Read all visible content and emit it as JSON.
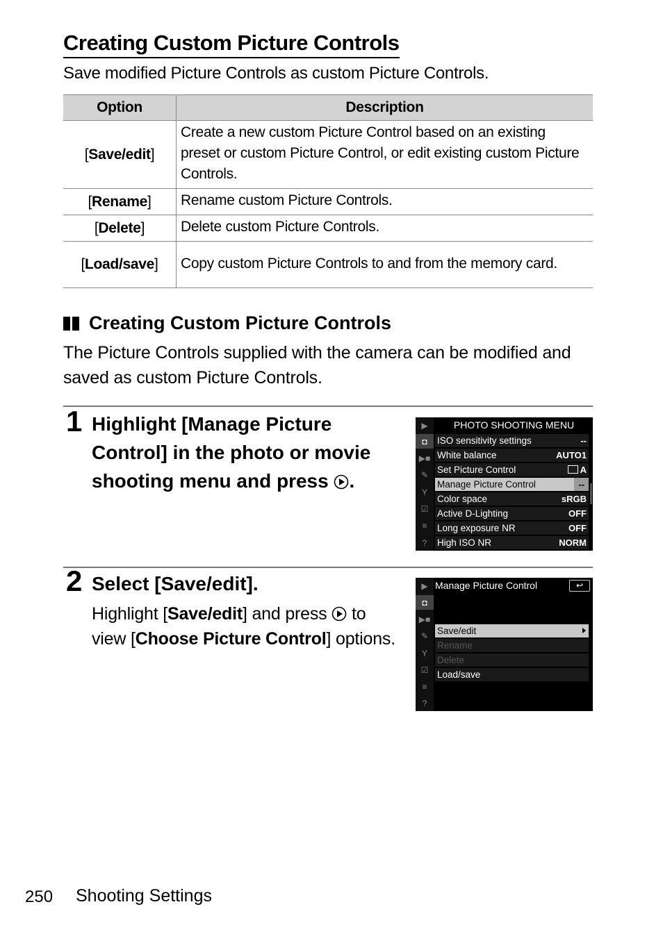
{
  "page": {
    "title": "Creating Custom Picture Controls",
    "subtitle": "Save modified Picture Controls as custom Picture Controls.",
    "table": {
      "headers": [
        "Option",
        "Description"
      ],
      "rows": [
        {
          "option": "Save/edit",
          "description": "Create a new custom Picture Control based on an existing preset or custom Picture Control, or edit existing custom Picture Controls."
        },
        {
          "option": "Rename",
          "description": "Rename custom Picture Controls."
        },
        {
          "option": "Delete",
          "description": "Delete custom Picture Controls."
        },
        {
          "option": "Load/save",
          "description": "Copy custom Picture Controls to and from the memory card."
        }
      ]
    },
    "section": {
      "heading": "Creating Custom Picture Controls",
      "paragraph": "The Picture Controls supplied with the camera can be modified and saved as custom Picture Controls."
    },
    "steps": [
      {
        "number": "1",
        "title_before": "Highlight [Manage Picture Control] in the photo or movie shooting menu and press",
        "title_after": ".",
        "screen": {
          "title": "PHOTO SHOOTING MENU",
          "items": [
            {
              "label": "ISO sensitivity settings",
              "value": "--"
            },
            {
              "label": "White balance",
              "value": "AUTO1"
            },
            {
              "label": "Set Picture Control",
              "value": "A"
            },
            {
              "label": "Manage Picture Control",
              "value": "--",
              "selected": true
            },
            {
              "label": "Color space",
              "value": "sRGB"
            },
            {
              "label": "Active D-Lighting",
              "value": "OFF"
            },
            {
              "label": "Long exposure NR",
              "value": "OFF"
            },
            {
              "label": "High ISO NR",
              "value": "NORM"
            }
          ]
        }
      },
      {
        "number": "2",
        "title": "Select [Save/edit].",
        "body": {
          "t1": "Highlight [",
          "b1": "Save/edit",
          "t2": "] and press",
          "t3": "to view [",
          "b2": "Choose Picture Control",
          "t4": "] options."
        },
        "screen": {
          "title": "Manage Picture Control",
          "back_label": "↩",
          "items": [
            {
              "label": "Save/edit",
              "selected": true
            },
            {
              "label": "Rename",
              "disabled": true
            },
            {
              "label": "Delete",
              "disabled": true
            },
            {
              "label": "Load/save"
            }
          ]
        }
      }
    ],
    "sidebar_icons": [
      "playback-icon",
      "camera-icon",
      "movie-icon",
      "pencil-icon",
      "wrench-icon",
      "retouch-icon",
      "my-menu-icon",
      "help-icon"
    ],
    "footer": {
      "page_number": "250",
      "section": "Shooting Settings"
    }
  }
}
